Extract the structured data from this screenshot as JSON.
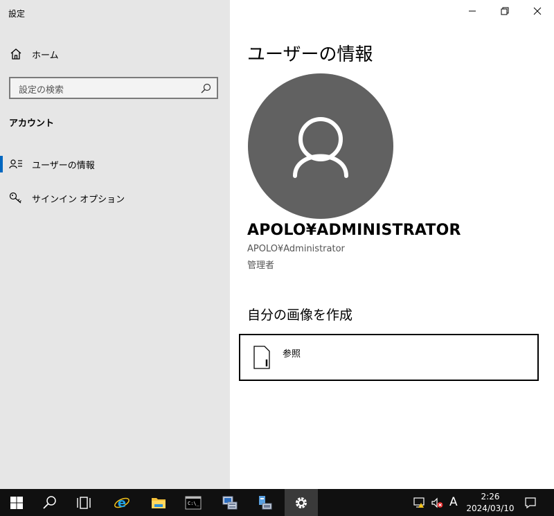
{
  "app": {
    "title": "設定"
  },
  "sidebar": {
    "home_label": "ホーム",
    "search_placeholder": "設定の検索",
    "section_label": "アカウント",
    "items": [
      {
        "label": "ユーザーの情報",
        "icon": "user-info-icon",
        "selected": true
      },
      {
        "label": "サインイン オプション",
        "icon": "key-icon",
        "selected": false
      }
    ]
  },
  "main": {
    "title": "ユーザーの情報",
    "user_name": "APOLO¥ADMINISTRATOR",
    "user_account": "APOLO¥Administrator",
    "user_role": "管理者",
    "create_picture_heading": "自分の画像を作成",
    "browse_label": "参照"
  },
  "taskbar": {
    "time": "2:26",
    "date": "2024/03/10",
    "ime_indicator": "A"
  },
  "colors": {
    "sidebar_bg": "#e6e6e6",
    "accent": "#0067c0",
    "avatar_bg": "#616161",
    "taskbar_bg": "#101010"
  }
}
